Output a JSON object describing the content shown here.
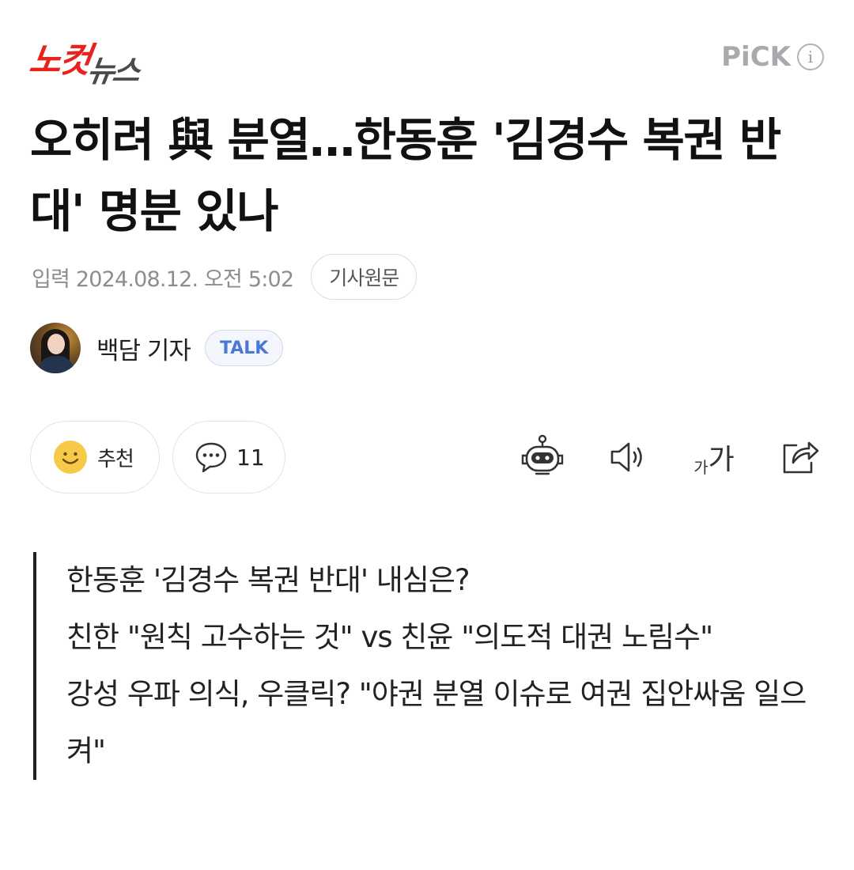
{
  "header": {
    "logo_part1": "노컷",
    "logo_part2": "뉴스",
    "pick_label": "PiCK",
    "info_symbol": "i"
  },
  "article": {
    "title": "오히려 與 분열…한동훈 '김경수 복권 반대' 명분 있나",
    "input_date": "입력 2024.08.12. 오전 5:02",
    "original_button": "기사원문",
    "reporter_name": "백담 기자",
    "talk_button": "TALK"
  },
  "actions": {
    "recommend_label": "추천",
    "comment_count": "11",
    "font_size_small": "가",
    "font_size_big": "가",
    "icons": [
      "robot-summary-icon",
      "speaker-icon",
      "font-size-icon",
      "share-icon"
    ]
  },
  "summary": {
    "lines": [
      "한동훈 '김경수 복권 반대' 내심은?",
      "친한 \"원칙 고수하는 것\" vs 친윤 \"의도적 대권 노림수\"",
      "강성 우파 의식, 우클릭? \"야권 분열 이슈로 여권 집안싸움 일으켜\""
    ]
  },
  "colors": {
    "logo_red": "#e8231e",
    "logo_gray": "#4a4a4a",
    "pick_gray": "#a9aaad",
    "talk_blue": "#4a78d4",
    "smile_yellow": "#f7c948"
  }
}
